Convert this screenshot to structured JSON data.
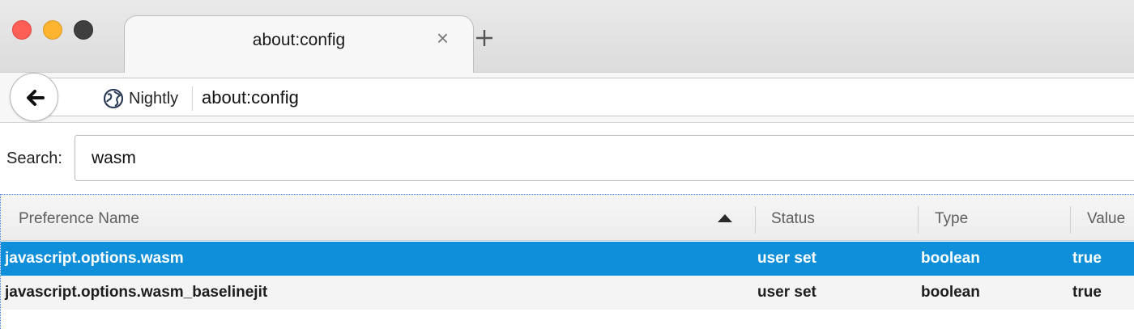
{
  "window": {
    "tab_title": "about:config",
    "tab_close_label": "×"
  },
  "navbar": {
    "identity_label": "Nightly",
    "url": "about:config"
  },
  "search": {
    "label": "Search:",
    "value": "wasm"
  },
  "columns": {
    "name": "Preference Name",
    "status": "Status",
    "type": "Type",
    "value": "Value"
  },
  "rows": [
    {
      "name": "javascript.options.wasm",
      "status": "user set",
      "type": "boolean",
      "value": "true",
      "selected": true
    },
    {
      "name": "javascript.options.wasm_baselinejit",
      "status": "user set",
      "type": "boolean",
      "value": "true",
      "selected": false
    }
  ],
  "colors": {
    "selection": "#0f8fda",
    "close_red": "#fd5f57",
    "minimize_yellow": "#fdb52f"
  },
  "icons": [
    "back-arrow-icon",
    "globe-icon",
    "close-icon",
    "plus-icon",
    "sort-ascending-icon"
  ]
}
